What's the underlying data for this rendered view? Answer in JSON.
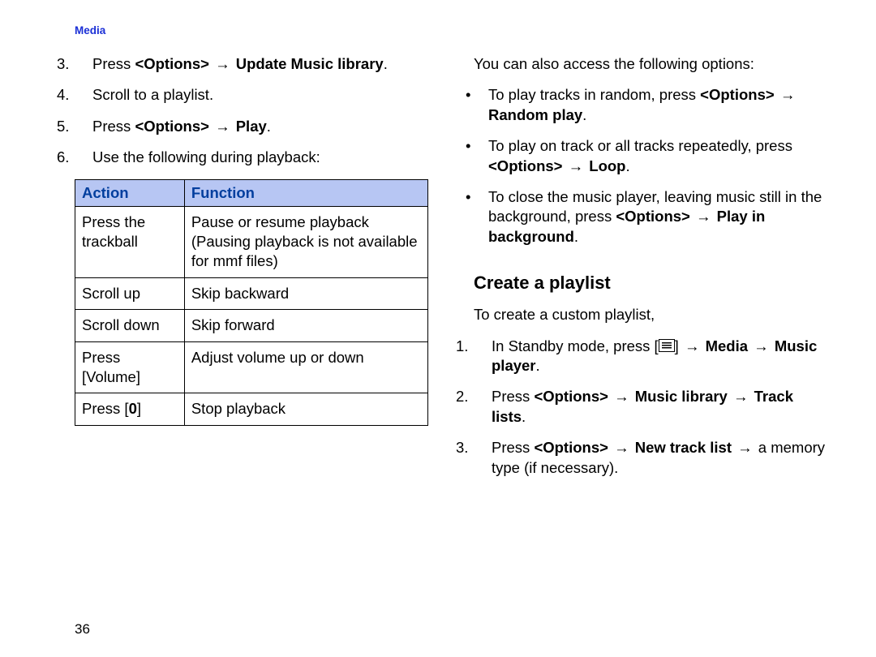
{
  "header": {
    "section": "Media"
  },
  "page_number": "36",
  "arrow": "→",
  "left": {
    "step3_pre": "Press ",
    "step3_b1": "<Options>",
    "step3_mid": " ",
    "step3_b2": "Update Music library",
    "step3_post": ".",
    "step4": "Scroll to a playlist.",
    "step5_pre": "Press ",
    "step5_b1": "<Options>",
    "step5_mid": " ",
    "step5_b2": "Play",
    "step5_post": ".",
    "step6": "Use the following during playback:",
    "table": {
      "h1": "Action",
      "h2": "Function",
      "r1a": "Press the trackball",
      "r1f": "Pause or resume playback (Pausing playback is not available for mmf files)",
      "r2a": "Scroll up",
      "r2f": "Skip backward",
      "r3a": "Scroll down",
      "r3f": "Skip forward",
      "r4a": "Press [Volume]",
      "r4f": "Adjust volume up or down",
      "r5a_pre": "Press [",
      "r5a_b": "0",
      "r5a_post": "]",
      "r5f": "Stop playback"
    }
  },
  "right": {
    "intro": "You can also access the following options:",
    "b1_pre": "To play tracks in random, press ",
    "b1_b1": "<Options>",
    "b1_mid": " ",
    "b1_b2": "Random play",
    "b1_post": ".",
    "b2_pre": "To play on track or all tracks repeatedly, press ",
    "b2_b1": "<Options>",
    "b2_mid": " ",
    "b2_b2": "Loop",
    "b2_post": ".",
    "b3_pre": "To close the music player, leaving music still in the background, press ",
    "b3_b1": "<Options>",
    "b3_mid": " ",
    "b3_b2": "Play in background",
    "b3_post": ".",
    "heading": "Create a playlist",
    "p1": "To create a custom playlist,",
    "s1_pre": "In Standby mode, press [",
    "s1_mid1": "] ",
    "s1_b1": "Media",
    "s1_mid2": " ",
    "s1_b2": "Music player",
    "s1_post": ".",
    "s2_pre": "Press ",
    "s2_b1": "<Options>",
    "s2_mid1": " ",
    "s2_b2": "Music library",
    "s2_mid2": " ",
    "s2_b3": "Track lists",
    "s2_post": ".",
    "s3_pre": "Press ",
    "s3_b1": "<Options>",
    "s3_mid1": " ",
    "s3_b2": "New track list",
    "s3_mid2": " ",
    "s3_post": "a memory type (if necessary)."
  }
}
